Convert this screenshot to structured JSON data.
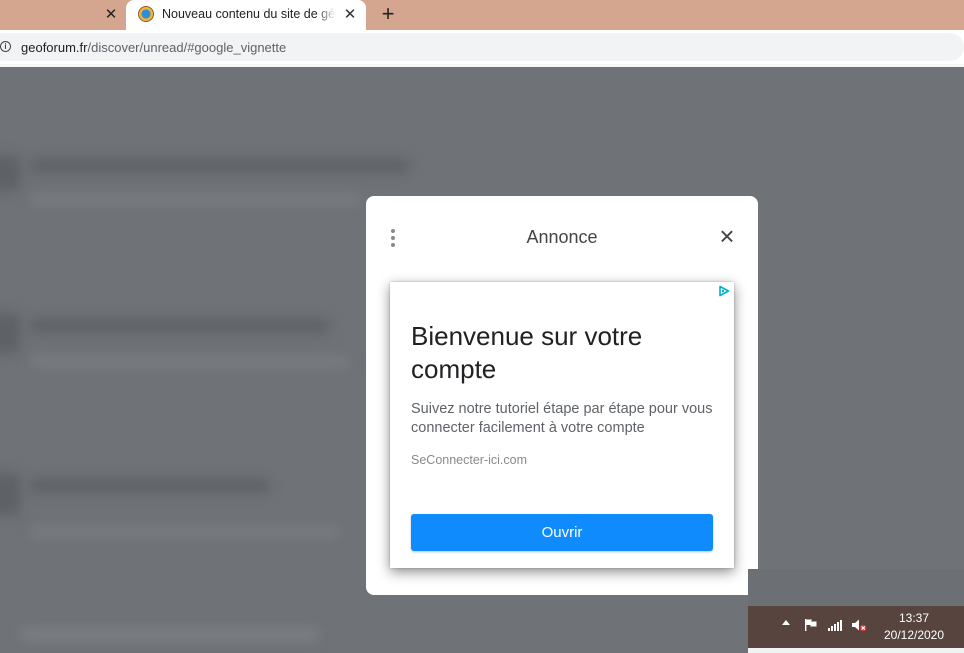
{
  "browser": {
    "active_tab": {
      "title": "Nouveau contenu du site de géoforum"
    },
    "address_bar": {
      "host": "geoforum.fr",
      "path": "/discover/unread/#google_vignette"
    }
  },
  "ad_dialog": {
    "title": "Annonce",
    "headline": "Bienvenue sur votre compte",
    "body": "Suivez notre tutoriel étape par étape pour vous connecter facilement à votre compte",
    "display_url": "SeConnecter-ici.com",
    "cta_label": "Ouvrir",
    "cta_color": "#0f8bfd"
  },
  "taskbar": {
    "time": "13:37",
    "date": "20/12/2020"
  },
  "icons": [
    "close-icon",
    "plus-icon",
    "info-icon",
    "kebab-menu-icon",
    "adchoices-icon",
    "chevron-up-icon",
    "flag-icon",
    "signal-icon",
    "volume-muted-icon"
  ]
}
